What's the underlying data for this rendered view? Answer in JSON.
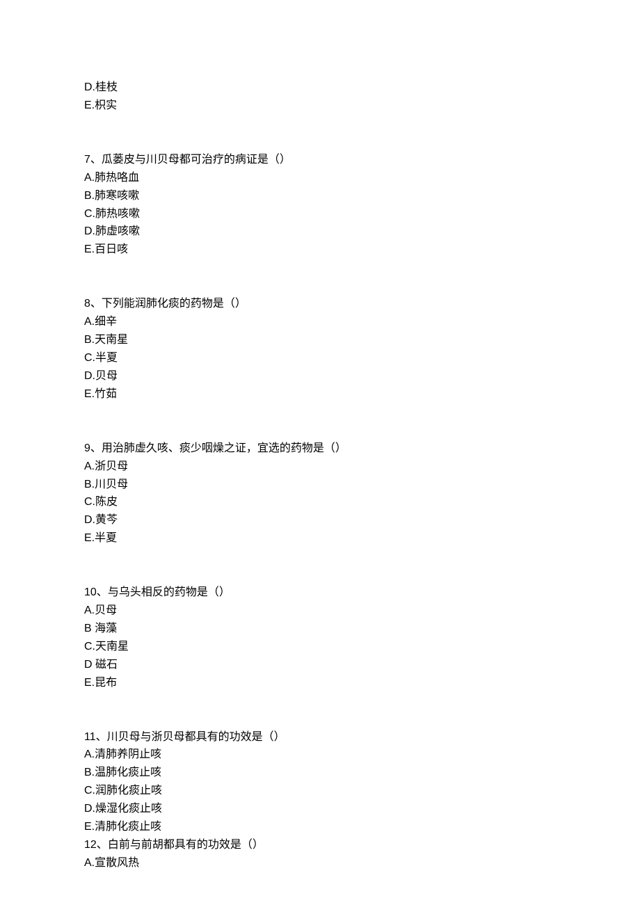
{
  "q6_partial": {
    "options": [
      {
        "label": "D.",
        "text": "桂枝"
      },
      {
        "label": "E.",
        "text": "枳实"
      }
    ]
  },
  "questions": [
    {
      "number": "7、",
      "stem": "瓜蒌皮与川贝母都可治疗的病证是（）",
      "options": [
        {
          "label": "A.",
          "text": "肺热咯血"
        },
        {
          "label": "B.",
          "text": "肺寒咳嗽"
        },
        {
          "label": "C.",
          "text": "肺热咳嗽"
        },
        {
          "label": "D.",
          "text": "肺虚咳嗽"
        },
        {
          "label": "E.",
          "text": "百日咳"
        }
      ]
    },
    {
      "number": "8、",
      "stem": "下列能润肺化痰的药物是（）",
      "options": [
        {
          "label": "A.",
          "text": "细辛"
        },
        {
          "label": "B.",
          "text": "天南星"
        },
        {
          "label": "C.",
          "text": "半夏"
        },
        {
          "label": "D.",
          "text": "贝母"
        },
        {
          "label": "E.",
          "text": "竹茹"
        }
      ]
    },
    {
      "number": "9、",
      "stem": "用治肺虚久咳、痰少咽燥之证，宜选的药物是（）",
      "options": [
        {
          "label": "A.",
          "text": "浙贝母"
        },
        {
          "label": "B.",
          "text": "川贝母"
        },
        {
          "label": "C.",
          "text": "陈皮"
        },
        {
          "label": "D.",
          "text": "黄芩"
        },
        {
          "label": "E.",
          "text": "半夏"
        }
      ]
    },
    {
      "number": "10、",
      "stem": "与乌头相反的药物是（）",
      "options": [
        {
          "label": "A.",
          "text": "贝母"
        },
        {
          "label": "B ",
          "text": "海藻"
        },
        {
          "label": "C.",
          "text": "天南星"
        },
        {
          "label": "D ",
          "text": "磁石"
        },
        {
          "label": "E.",
          "text": "昆布"
        }
      ]
    },
    {
      "number": "11、",
      "stem": "川贝母与浙贝母都具有的功效是（）",
      "options": [
        {
          "label": "A.",
          "text": "清肺养阴止咳"
        },
        {
          "label": "B.",
          "text": "温肺化痰止咳"
        },
        {
          "label": "C.",
          "text": "润肺化痰止咳"
        },
        {
          "label": "D.",
          "text": "燥湿化痰止咳"
        },
        {
          "label": "E.",
          "text": "清肺化痰止咳"
        }
      ]
    },
    {
      "number": "12、",
      "stem": "白前与前胡都具有的功效是（）",
      "options": [
        {
          "label": "A.",
          "text": "宣散风热"
        }
      ]
    }
  ]
}
